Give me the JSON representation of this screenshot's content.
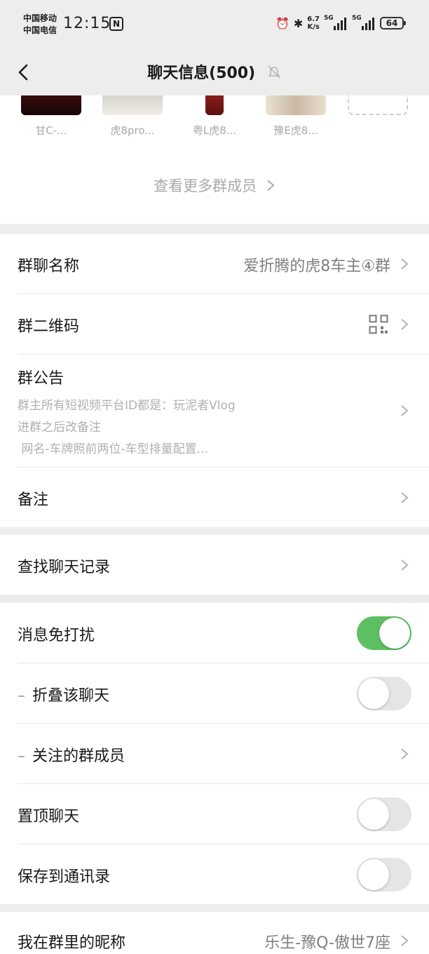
{
  "status_bar": {
    "carrier_1": "中国移动",
    "carrier_2": "中国电信",
    "time": "12:15",
    "nfc": "N",
    "speed_value": "6.7",
    "speed_unit": "K/s",
    "signal_1": "5G",
    "signal_2": "5G",
    "battery": "64"
  },
  "nav": {
    "title": "聊天信息(500)"
  },
  "members": [
    {
      "name": "甘C-..."
    },
    {
      "name": "虎8pro..."
    },
    {
      "name": "粤L虎8..."
    },
    {
      "name": "豫E虎8..."
    }
  ],
  "more_members": "查看更多群成员",
  "settings": {
    "group_name_label": "群聊名称",
    "group_name_value": "爱折腾的虎8车主④群",
    "qr_label": "群二维码",
    "notice_label": "群公告",
    "notice_line_1": "群主所有短视频平台ID都是：玩泥者Vlog",
    "notice_line_2": "进群之后改备注",
    "notice_line_3": " 网名-车牌照前两位-车型排量配置...",
    "remark_label": "备注",
    "search_label": "查找聊天记录",
    "dnd_label": "消息免打扰",
    "fold_label": "折叠该聊天",
    "follow_label": "关注的群成员",
    "pin_label": "置顶聊天",
    "save_contacts_label": "保存到通讯录",
    "nickname_label": "我在群里的昵称",
    "nickname_value": "乐生-豫Q-傲世7座",
    "dash": "–"
  },
  "toggles": {
    "dnd": true,
    "fold": false,
    "pin": false,
    "save_contacts": false
  },
  "colors": {
    "toggle_on": "#5cbf62",
    "page_bg": "#ededed"
  }
}
